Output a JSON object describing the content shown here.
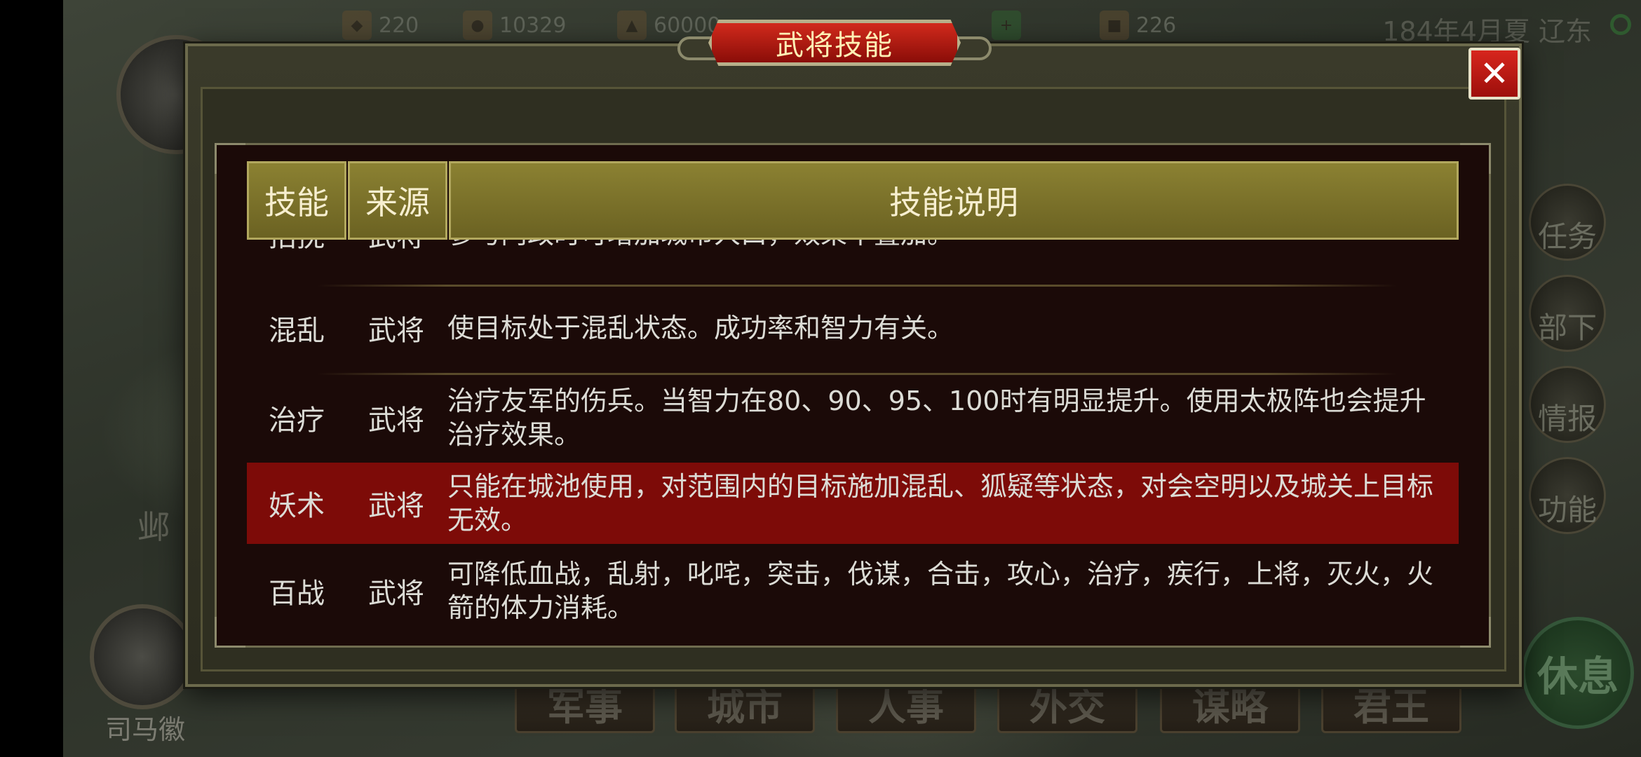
{
  "topbar": {
    "resources": [
      {
        "icon": "food-icon",
        "value": "220"
      },
      {
        "icon": "gold-icon",
        "value": "10329"
      },
      {
        "icon": "troops-icon",
        "value": "60000"
      },
      {
        "icon": "plus-icon",
        "value": ""
      },
      {
        "icon": "horse-icon",
        "value": "226"
      }
    ],
    "date_location": "184年4月夏 辽东"
  },
  "map": {
    "city_label": "邺",
    "officer_name": "司马徽"
  },
  "side_menu": [
    {
      "label": "任务",
      "icon": "flag-icon"
    },
    {
      "label": "部下",
      "icon": "soldier-icon"
    },
    {
      "label": "情报",
      "icon": "castle-icon"
    },
    {
      "label": "功能",
      "icon": "gear-icon"
    }
  ],
  "rest_button": "休息",
  "bottom_tabs": [
    "军事",
    "城市",
    "人事",
    "外交",
    "谋略",
    "君王"
  ],
  "dialog": {
    "title": "武将技能",
    "close_glyph": "✕",
    "columns": {
      "skill": "技能",
      "source": "来源",
      "description": "技能说明"
    },
    "partial_row": {
      "skill": "招抚",
      "source": "武将",
      "description": "参与内政时可增加城市人口，效果不叠加。"
    },
    "rows": [
      {
        "skill": "混乱",
        "source": "武将",
        "description": "使目标处于混乱状态。成功率和智力有关。"
      },
      {
        "skill": "治疗",
        "source": "武将",
        "description": "治疗友军的伤兵。当智力在80、90、95、100时有明显提升。使用太极阵也会提升治疗效果。"
      },
      {
        "skill": "妖术",
        "source": "武将",
        "description": "只能在城池使用，对范围内的目标施加混乱、狐疑等状态，对会空明以及城关上目标无效。",
        "selected": true
      },
      {
        "skill": "百战",
        "source": "武将",
        "description": "可降低血战，乱射，叱咤，突击，伐谋，合击，攻心，治疗，疾行，上将，灭火，火箭的体力消耗。"
      }
    ]
  },
  "colors": {
    "title_red": "#c01f14",
    "header_gold": "#7e742a",
    "selected_row": "#7d0b08",
    "panel_bg": "#1b0a08"
  }
}
